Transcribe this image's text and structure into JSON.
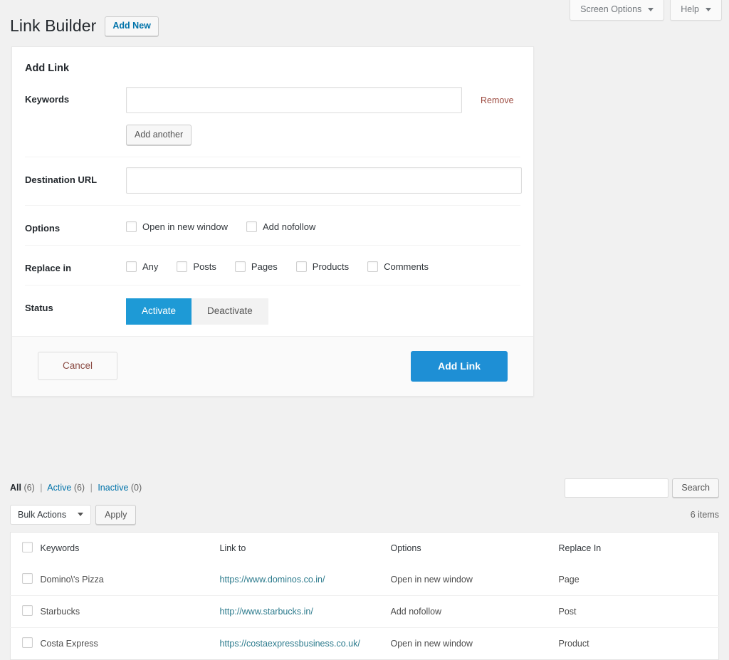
{
  "topbar": {
    "screen_options_label": "Screen Options",
    "help_label": "Help",
    "caret_icon": "chevron-down-icon"
  },
  "header": {
    "page_title": "Link Builder",
    "add_new_label": "Add New"
  },
  "form": {
    "card_title": "Add Link",
    "keywords": {
      "label": "Keywords",
      "value": "",
      "placeholder": "",
      "remove_label": "Remove",
      "add_another_label": "Add another"
    },
    "destination_url": {
      "label": "Destination URL",
      "value": "",
      "placeholder": ""
    },
    "options": {
      "label": "Options",
      "items": [
        {
          "label": "Open in new window",
          "checked": false
        },
        {
          "label": "Add nofollow",
          "checked": false
        }
      ]
    },
    "replace_in": {
      "label": "Replace in",
      "items": [
        {
          "label": "Any",
          "checked": false
        },
        {
          "label": "Posts",
          "checked": false
        },
        {
          "label": "Pages",
          "checked": false
        },
        {
          "label": "Products",
          "checked": false
        },
        {
          "label": "Comments",
          "checked": false
        }
      ]
    },
    "status": {
      "label": "Status",
      "activate_label": "Activate",
      "deactivate_label": "Deactivate",
      "selected": "Activate"
    },
    "footer": {
      "cancel_label": "Cancel",
      "submit_label": "Add Link"
    }
  },
  "list": {
    "filters": [
      {
        "label": "All",
        "count": "(6)",
        "current": true
      },
      {
        "label": "Active",
        "count": "(6)",
        "current": false
      },
      {
        "label": "Inactive",
        "count": "(0)",
        "current": false
      }
    ],
    "separator": "|",
    "search": {
      "value": "",
      "placeholder": "",
      "button_label": "Search"
    },
    "bulk_actions": {
      "selected_label": "Bulk Actions",
      "apply_label": "Apply",
      "caret_icon": "chevron-down-icon"
    },
    "items_count": "6 items",
    "columns": [
      "Keywords",
      "Link to",
      "Options",
      "Replace In"
    ],
    "rows": [
      {
        "keywords": "Domino\\'s Pizza",
        "link_to": "https://www.dominos.co.in/",
        "options": "Open in new window",
        "replace_in": "Page"
      },
      {
        "keywords": "Starbucks",
        "link_to": "http://www.starbucks.in/",
        "options": "Add nofollow",
        "replace_in": "Post"
      },
      {
        "keywords": "Costa Express",
        "link_to": "https://costaexpressbusiness.co.uk/",
        "options": "Open in new window",
        "replace_in": "Product"
      }
    ]
  },
  "colors": {
    "accent_blue": "#1e9ad6",
    "submit_blue": "#1e8fd5",
    "link_blue": "#0073aa",
    "url_teal": "#2b7a8c",
    "remove_red": "#9c4a3f",
    "page_bg": "#f1f1f1"
  }
}
